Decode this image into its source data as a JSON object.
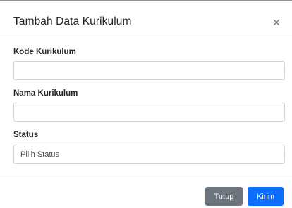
{
  "modal": {
    "title": "Tambah Data Kurikulum",
    "close_symbol": "×"
  },
  "form": {
    "kode": {
      "label": "Kode Kurikulum",
      "value": ""
    },
    "nama": {
      "label": "Nama Kurikulum",
      "value": ""
    },
    "status": {
      "label": "Status",
      "selected": "Pilih Status"
    }
  },
  "footer": {
    "close_label": "Tutup",
    "submit_label": "Kirim"
  },
  "colors": {
    "primary": "#0d6efd",
    "secondary": "#6c757d",
    "border": "#ced4da"
  }
}
